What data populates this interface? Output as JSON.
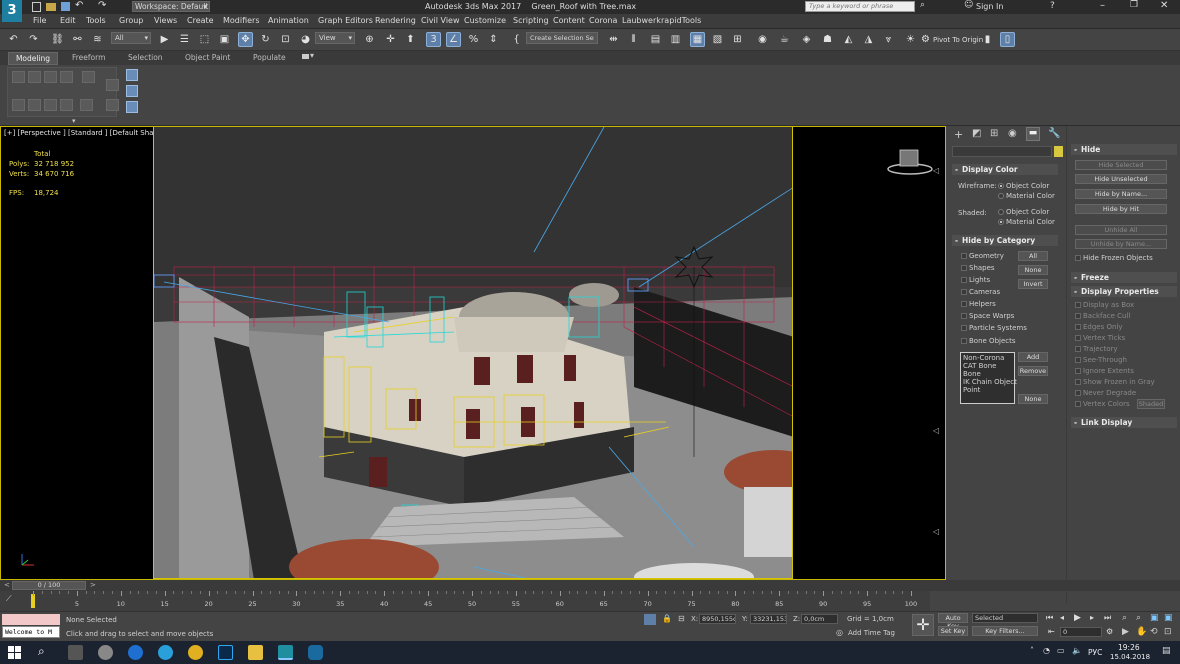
{
  "window": {
    "workspace_label": "Workspace: Default",
    "title": "Autodesk 3ds Max 2017",
    "file_name": "Green_Roof with Tree.max",
    "search_placeholder": "Type a keyword or phrase",
    "sign_in": "Sign In"
  },
  "menu": [
    "File",
    "Edit",
    "Tools",
    "Group",
    "Views",
    "Create",
    "Modifiers",
    "Animation",
    "Graph Editors",
    "Rendering",
    "Civil View",
    "Customize",
    "Scripting",
    "Content",
    "Corona",
    "Laubwerk",
    "rapidTools"
  ],
  "toolbar": {
    "filter_select": "All",
    "view_select": "View",
    "selection_set": "Create Selection Se",
    "pivot_label": "Pivot To Origin"
  },
  "ribbon_tabs": [
    "Modeling",
    "Freeform",
    "Selection",
    "Object Paint",
    "Populate"
  ],
  "viewport": {
    "label": "[+] [Perspective ] [Standard ] [Default Shading ]",
    "stats": {
      "total_label": "Total",
      "polys_label": "Polys:",
      "polys_value": "32 718 952",
      "verts_label": "Verts:",
      "verts_value": "34 670 716",
      "fps_label": "FPS:",
      "fps_value": "18,724"
    }
  },
  "display_panel": {
    "display_color_title": "Display Color",
    "wireframe_label": "Wireframe:",
    "shaded_label": "Shaded:",
    "object_color": "Object Color",
    "material_color": "Material Color",
    "hide_by_category_title": "Hide by Category",
    "categories": [
      "Geometry",
      "Shapes",
      "Lights",
      "Cameras",
      "Helpers",
      "Space Warps",
      "Particle Systems",
      "Bone Objects"
    ],
    "cat_buttons": [
      "All",
      "None",
      "Invert"
    ],
    "list_items": [
      "Non-Corona",
      "CAT Bone",
      "Bone",
      "IK Chain Object",
      "Point"
    ],
    "add_btn": "Add",
    "remove_btn": "Remove",
    "none_btn": "None"
  },
  "hide_panel": {
    "hide_title": "Hide",
    "hide_selected": "Hide Selected",
    "hide_unselected": "Hide Unselected",
    "hide_by_name": "Hide by Name...",
    "hide_by_hit": "Hide by Hit",
    "unhide_all": "Unhide All",
    "unhide_by_name": "Unhide by Name...",
    "hide_frozen": "Hide Frozen Objects",
    "freeze_title": "Freeze",
    "display_props_title": "Display Properties",
    "props": [
      "Display as Box",
      "Backface Cull",
      "Edges Only",
      "Vertex Ticks",
      "Trajectory",
      "See-Through",
      "Ignore Extents",
      "Show Frozen in Gray",
      "Never Degrade",
      "Vertex Colors"
    ],
    "shaded_btn": "Shaded",
    "link_display_title": "Link Display"
  },
  "timeline": {
    "frame_counter": "0 / 100",
    "ticks": [
      "0",
      "5",
      "10",
      "15",
      "20",
      "25",
      "30",
      "35",
      "40",
      "45",
      "50",
      "55",
      "60",
      "65",
      "70",
      "75",
      "80",
      "85",
      "90",
      "95",
      "100"
    ]
  },
  "status": {
    "selection": "None Selected",
    "prompt": "Click and drag to select and move objects",
    "maxscript": "Welcome to M",
    "x_label": "X:",
    "x_value": "8950,155c",
    "y_label": "Y:",
    "y_value": "33231,153",
    "z_label": "Z:",
    "z_value": "0,0cm",
    "grid": "Grid = 1,0cm",
    "add_time_tag": "Add Time Tag",
    "auto_key": "Auto Key",
    "set_key": "Set Key",
    "selected_dropdown": "Selected",
    "key_filters": "Key Filters...",
    "frame_field": "0"
  },
  "taskbar": {
    "lang": "РУС",
    "time": "19:26",
    "date": "15.04.2018"
  },
  "colors": {
    "viewport_border": "#d4c400",
    "active_button": "#5e7fa8",
    "wire_red": "#c0204a",
    "wire_cyan": "#22d8d8",
    "wire_yellow": "#e8d020"
  }
}
